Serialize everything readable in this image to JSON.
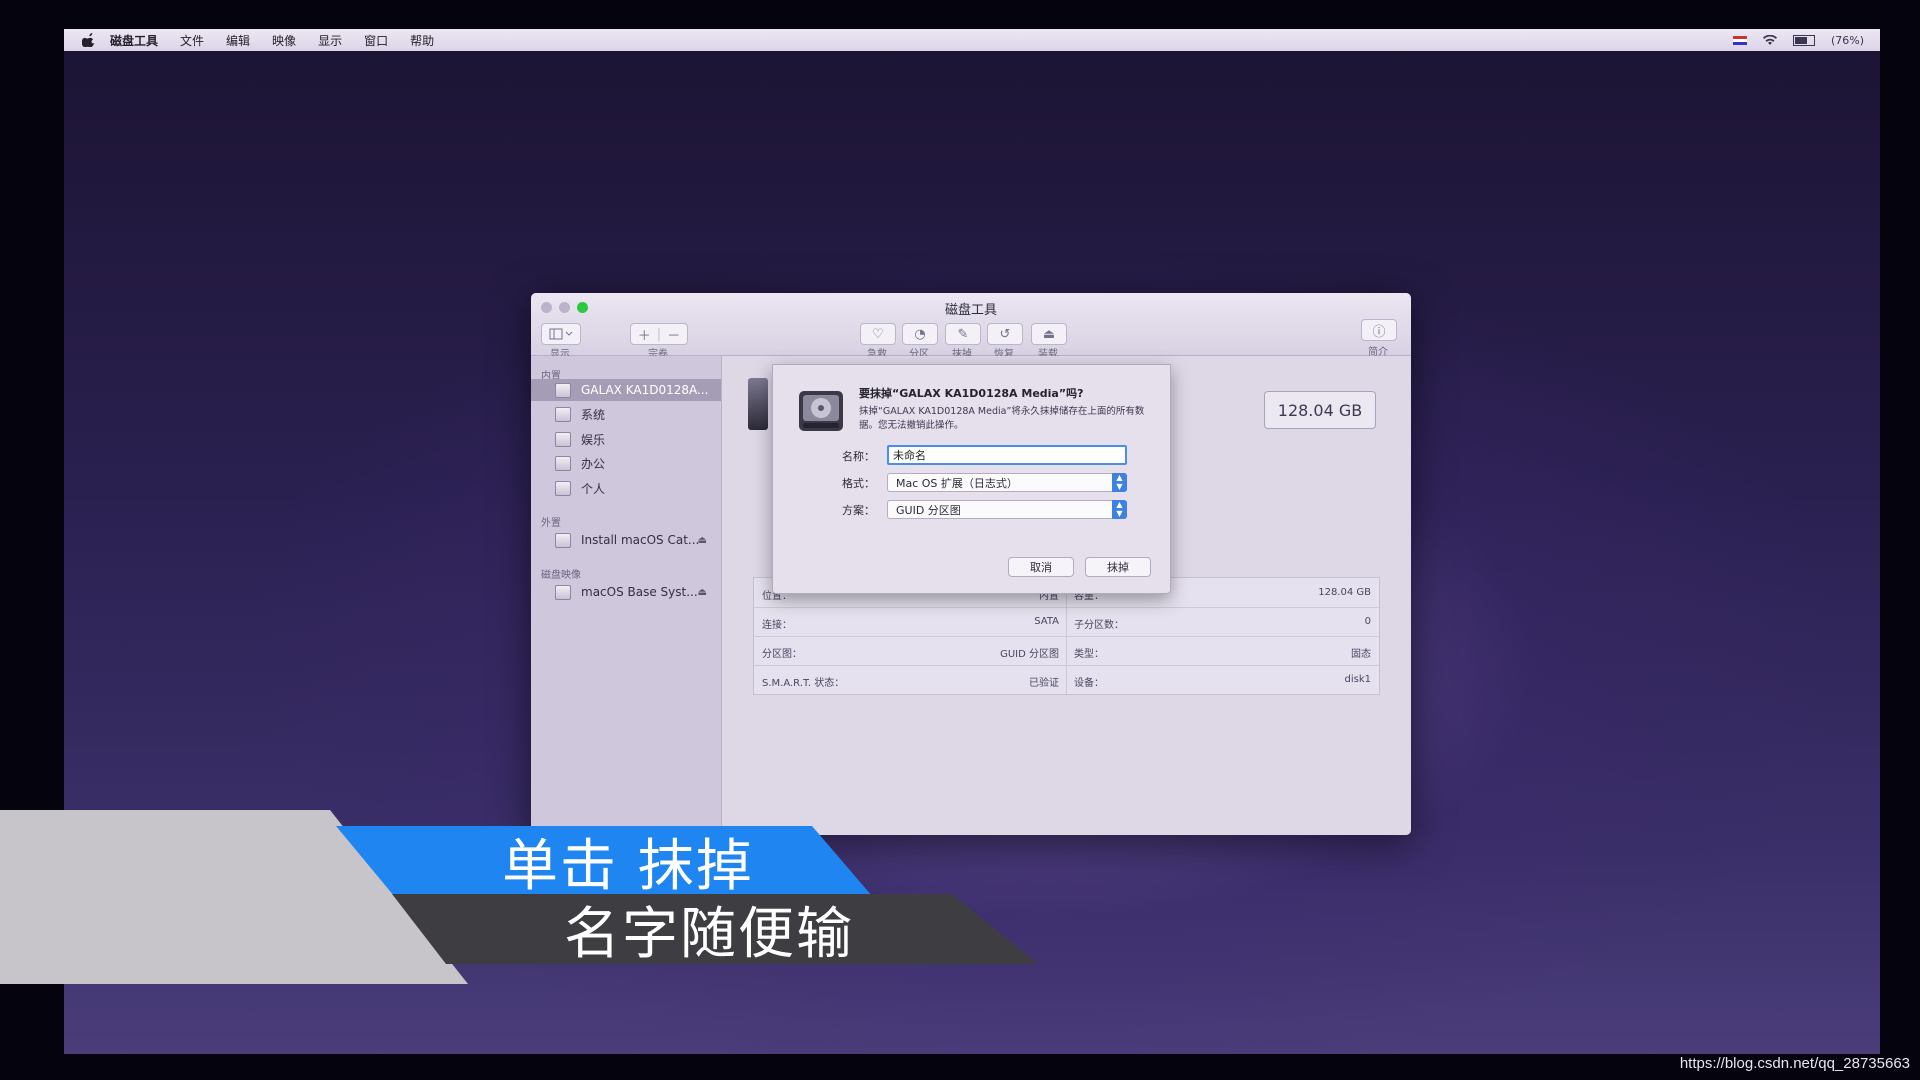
{
  "menubar": {
    "items": [
      "磁盘工具",
      "文件",
      "编辑",
      "映像",
      "显示",
      "窗口",
      "帮助"
    ],
    "battery": "(76%)"
  },
  "window": {
    "title": "磁盘工具",
    "toolbar": {
      "view_label": "显示",
      "volume_label": "宗卷",
      "actions": [
        "急救",
        "分区",
        "抹掉",
        "恢复",
        "装载"
      ],
      "info_label": "简介"
    }
  },
  "sidebar": {
    "sections": [
      {
        "title": "内置",
        "items": [
          "GALAX KA1D0128A...",
          "系统",
          "娱乐",
          "办公",
          "个人"
        ]
      },
      {
        "title": "外置",
        "items": [
          "Install macOS Cat..."
        ]
      },
      {
        "title": "磁盘映像",
        "items": [
          "macOS Base Syst..."
        ]
      }
    ]
  },
  "main": {
    "capacity": "128.04 GB",
    "info_rows": [
      {
        "l_label": "位置：",
        "l_value": "内置",
        "r_label": "容量：",
        "r_value": "128.04 GB"
      },
      {
        "l_label": "连接：",
        "l_value": "SATA",
        "r_label": "子分区数：",
        "r_value": "0"
      },
      {
        "l_label": "分区图：",
        "l_value": "GUID 分区图",
        "r_label": "类型：",
        "r_value": "固态"
      },
      {
        "l_label": "S.M.A.R.T. 状态：",
        "l_value": "已验证",
        "r_label": "设备：",
        "r_value": "disk1"
      }
    ]
  },
  "dialog": {
    "title": "要抹掉“GALAX KA1D0128A Media”吗?",
    "message": "抹掉“GALAX KA1D0128A Media”将永久抹掉储存在上面的所有数据。您无法撤销此操作。",
    "name_label": "名称：",
    "name_value": "未命名",
    "format_label": "格式：",
    "format_value": "Mac OS 扩展（日志式）",
    "scheme_label": "方案：",
    "scheme_value": "GUID 分区图",
    "cancel_label": "取消",
    "erase_label": "抹掉"
  },
  "caption": {
    "line1": "单击 抹掉",
    "line2": "名字随便输"
  },
  "watermark": "https://blog.csdn.net/qq_28735663",
  "colors": {
    "accent": "#1f86f1",
    "caption_dark": "#3e3e42",
    "traffic_green": "#2bc840"
  }
}
